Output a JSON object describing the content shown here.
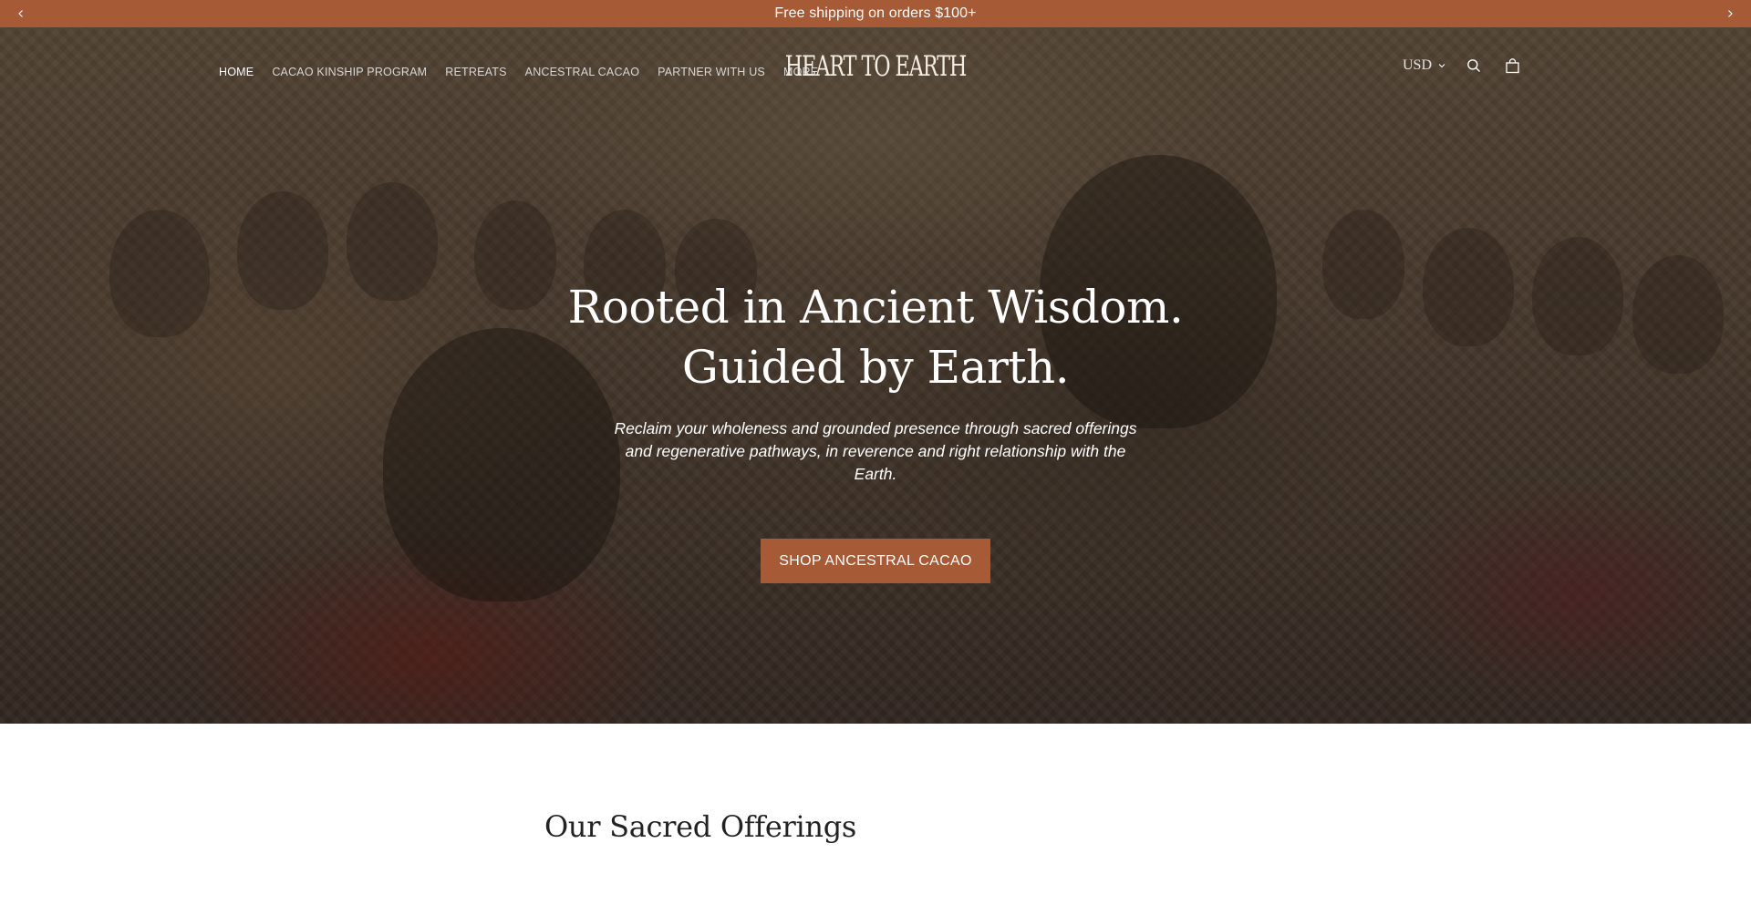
{
  "announcement": {
    "text": "Free shipping on orders $100+",
    "prev_icon": "chevron-left-icon",
    "next_icon": "chevron-right-icon"
  },
  "header": {
    "nav": [
      {
        "label": "HOME",
        "active": true
      },
      {
        "label": "CACAO KINSHIP PROGRAM",
        "active": false
      },
      {
        "label": "RETREATS",
        "active": false
      },
      {
        "label": "ANCESTRAL CACAO",
        "active": false
      },
      {
        "label": "PARTNER WITH US",
        "active": false
      },
      {
        "label": "MORE",
        "active": false
      }
    ],
    "logo_text": "HEART TO EARTH",
    "currency": "USD",
    "icons": [
      "chevron-down-icon",
      "search-icon",
      "cart-icon"
    ]
  },
  "hero": {
    "title_line1": "Rooted in Ancient Wisdom.",
    "title_line2": "Guided by Earth.",
    "subtitle": "Reclaim your wholeness and grounded presence through sacred offerings and regenerative pathways, in reverence and right relationship with the Earth.",
    "cta_label": "SHOP ANCESTRAL CACAO"
  },
  "offerings": {
    "title": "Our Sacred Offerings"
  },
  "colors": {
    "accent": "#a65a35",
    "text_dark": "#222222",
    "white": "#ffffff"
  }
}
